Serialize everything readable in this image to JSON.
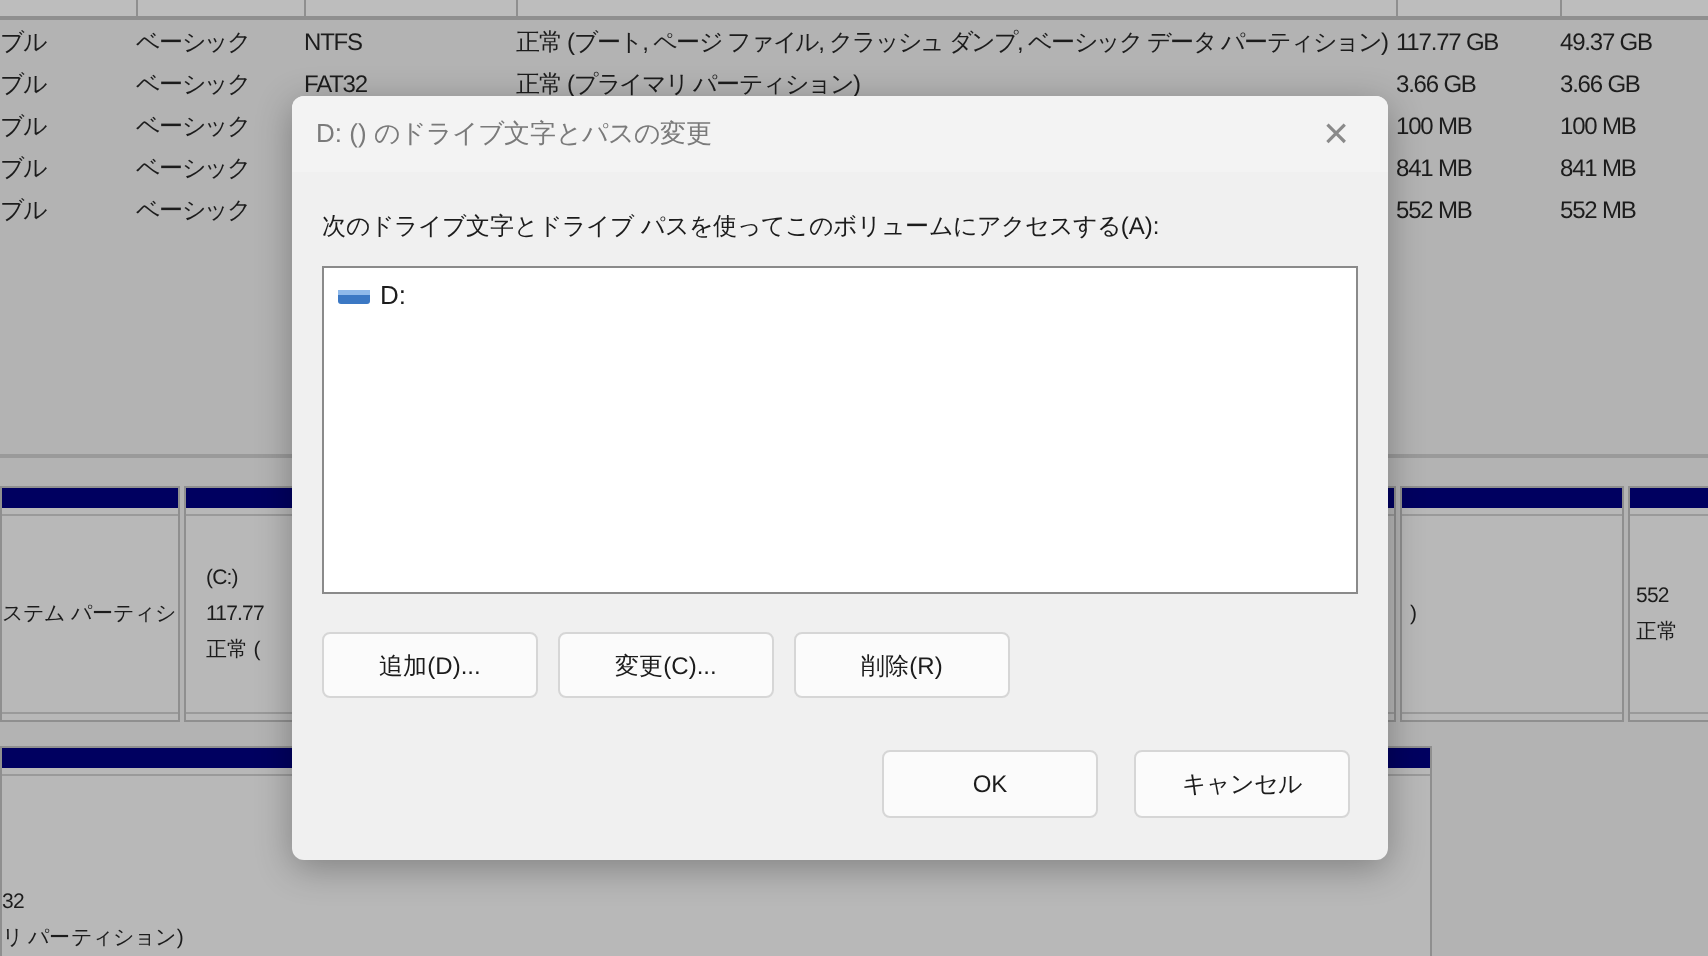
{
  "volume_list": {
    "rows": [
      {
        "layout": "ブル",
        "type": "ベーシック",
        "file_system": "NTFS",
        "status": "正常 (ブート, ページ ファイル, クラッシュ ダンプ, ベーシック データ パーティション)",
        "capacity": "117.77 GB",
        "free": "49.37 GB"
      },
      {
        "layout": "ブル",
        "type": "ベーシック",
        "file_system": "FAT32",
        "status": "正常 (プライマリ パーティション)",
        "capacity": "3.66 GB",
        "free": "3.66 GB"
      },
      {
        "layout": "ブル",
        "type": "ベーシック",
        "capacity": "100 MB",
        "free": "100 MB"
      },
      {
        "layout": "ブル",
        "type": "ベーシック",
        "capacity": "841 MB",
        "free": "841 MB"
      },
      {
        "layout": "ブル",
        "type": "ベーシック",
        "capacity": "552 MB",
        "free": "552 MB"
      }
    ]
  },
  "disk_map": [
    {
      "partitions": [
        {
          "lines": [
            "ステム パーティシ"
          ]
        },
        {
          "lines": [
            "(C:)",
            "117.77",
            "正常 ("
          ]
        },
        {
          "lines": [
            ")"
          ]
        },
        {
          "lines": [
            "552",
            "正常"
          ]
        }
      ]
    },
    {
      "partitions": [
        {
          "lines": [
            "32",
            "リ パーティション)"
          ]
        }
      ]
    }
  ],
  "dialog": {
    "title": "D: () のドライブ文字とパスの変更",
    "close": "×",
    "label": "次のドライブ文字とドライブ パスを使ってこのボリュームにアクセスする(A):",
    "items": [
      {
        "label": "D:",
        "selected": false
      }
    ],
    "actions": [
      "追加(D)...",
      "変更(C)...",
      "削除(R)"
    ],
    "buttons": [
      "OK",
      "キャンセル"
    ]
  }
}
